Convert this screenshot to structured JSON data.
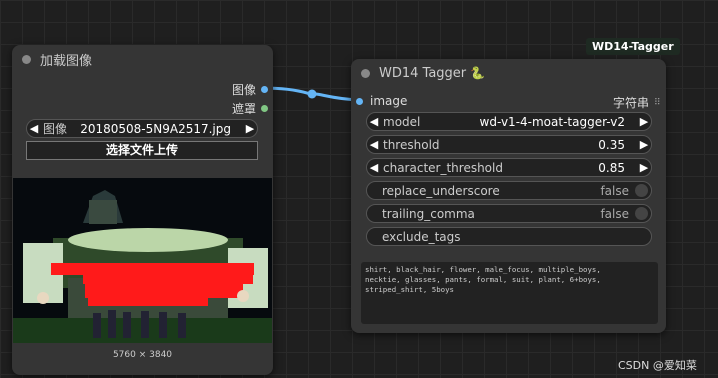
{
  "load_node": {
    "title": "加载图像",
    "outputs": [
      "图像",
      "遮罩"
    ],
    "image_widget": {
      "label": "图像",
      "value": "20180508-5N9A2517.jpg"
    },
    "upload_label": "选择文件上传",
    "dimensions": "5760 × 3840"
  },
  "tagger_node": {
    "badge": "WD14-Tagger",
    "title": "WD14 Tagger",
    "title_emoji": "🐍",
    "input_label": "image",
    "output_label": "字符串",
    "widgets": {
      "model": {
        "label": "model",
        "value": "wd-v1-4-moat-tagger-v2"
      },
      "threshold": {
        "label": "threshold",
        "value": "0.35"
      },
      "character_threshold": {
        "label": "character_threshold",
        "value": "0.85"
      },
      "replace_underscore": {
        "label": "replace_underscore",
        "value": "false"
      },
      "trailing_comma": {
        "label": "trailing_comma",
        "value": "false"
      },
      "exclude_tags": {
        "label": "exclude_tags"
      }
    },
    "output_text": "shirt, black_hair, flower, male_focus, multiple_boys,\nnecktie, glasses, pants, formal, suit, plant, 6+boys,\nstriped_shirt, 5boys"
  },
  "watermark": "CSDN @爱知菜",
  "colors": {
    "image_socket": "#64b5f6",
    "mask_socket": "#81c784",
    "link": "#64b5f6"
  }
}
